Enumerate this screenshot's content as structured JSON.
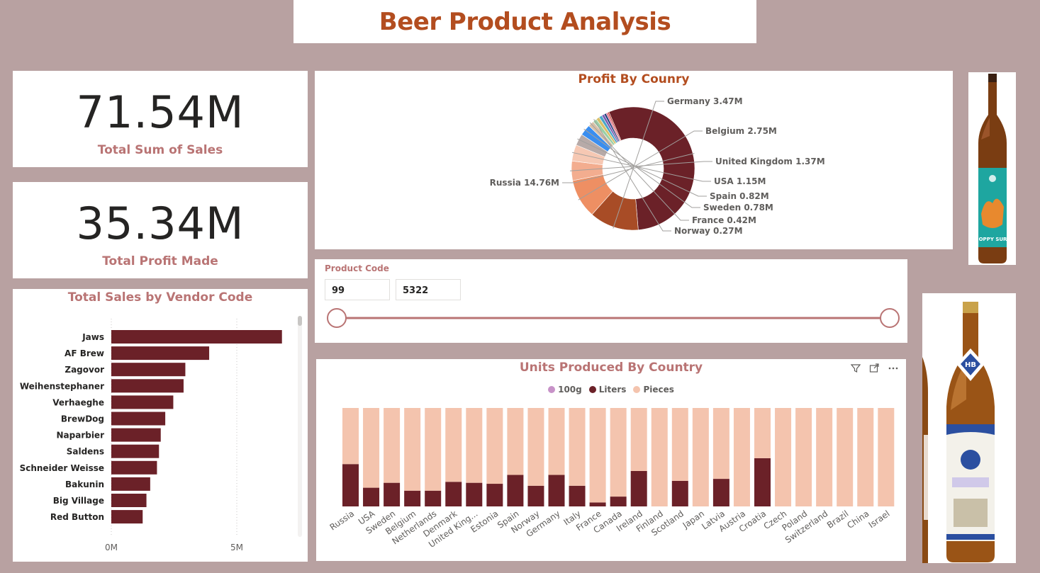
{
  "page": {
    "title": "Beer Product Analysis"
  },
  "kpis": {
    "sales": {
      "value": "71.54M",
      "label": "Total Sum of Sales"
    },
    "profit": {
      "value": "35.34M",
      "label": "Total Profit Made"
    }
  },
  "slicer": {
    "label": "Product Code",
    "min": "99",
    "max": "5322",
    "range": [
      99,
      5322
    ]
  },
  "images": {
    "bottle1_label": "HOPPY SURF",
    "bottle2_label": "HB"
  },
  "colors": {
    "accent": "#b34d1f",
    "label": "#b97474",
    "maroon": "#6b2128",
    "pieces": "#f4c4ae",
    "g100": "#c792c8"
  },
  "chart_data": [
    {
      "type": "bar",
      "orientation": "horizontal",
      "title": "Total Sales by Vendor Code",
      "categories": [
        "Jaws",
        "AF Brew",
        "Zagovor",
        "Weihenstephaner",
        "Verhaeghe",
        "BrewDog",
        "Naparbier",
        "Saldens",
        "Schneider Weisse",
        "Bakunin",
        "Big Village",
        "Red Button"
      ],
      "values": [
        6.8,
        3.9,
        2.95,
        2.88,
        2.47,
        2.15,
        1.97,
        1.9,
        1.82,
        1.55,
        1.4,
        1.25
      ],
      "value_unit": "M",
      "xlim": [
        0,
        8
      ],
      "x_ticks": [
        "0M",
        "5M"
      ],
      "grid": true
    },
    {
      "type": "pie",
      "donut": true,
      "title": "Profit By Counry",
      "slices": [
        {
          "label": "Russia",
          "value": 14.76,
          "text": "Russia 14.76M",
          "color": "#6b2128"
        },
        {
          "label": "Germany",
          "value": 3.47,
          "text": "Germany 3.47M",
          "color": "#a84c26"
        },
        {
          "label": "Belgium",
          "value": 2.75,
          "text": "Belgium 2.75M",
          "color": "#ee8f63"
        },
        {
          "label": "United Kingdom",
          "value": 1.37,
          "text": "United Kingdom 1.37M",
          "color": "#f3ad8f"
        },
        {
          "label": "USA",
          "value": 1.15,
          "text": "USA 1.15M",
          "color": "#f6c8b3"
        },
        {
          "label": "Spain",
          "value": 0.82,
          "text": "Spain 0.82M",
          "color": "#b7aaa8"
        },
        {
          "label": "Sweden",
          "value": 0.78,
          "text": "Sweden 0.78M",
          "color": "#3a8ef0"
        },
        {
          "label": "France",
          "value": 0.42,
          "text": "France 0.42M",
          "color": "#d8c0a8"
        },
        {
          "label": "Norway",
          "value": 0.27,
          "text": "Norway 0.27M",
          "color": "#9ad0a6"
        },
        {
          "label": "",
          "value": 0.24,
          "text": "",
          "color": "#d9c06a"
        },
        {
          "label": "",
          "value": 0.22,
          "text": "",
          "color": "#4aa6c9"
        },
        {
          "label": "",
          "value": 0.18,
          "text": "",
          "color": "#7a5ab0"
        },
        {
          "label": "",
          "value": 0.15,
          "text": "",
          "color": "#1f3e7a"
        },
        {
          "label": "",
          "value": 0.12,
          "text": "",
          "color": "#e06b8a"
        },
        {
          "label": "",
          "value": 0.1,
          "text": "",
          "color": "#c0392b"
        }
      ]
    },
    {
      "type": "bar",
      "stacked": "100%",
      "title": "Units Produced By Country",
      "legend": [
        "100g",
        "Liters",
        "Pieces"
      ],
      "legend_position": "top-center",
      "categories": [
        "Russia",
        "USA",
        "Sweden",
        "Belgium",
        "Netherlands",
        "Denmark",
        "United King...",
        "Estonia",
        "Spain",
        "Norway",
        "Germany",
        "Italy",
        "France",
        "Canada",
        "Ireland",
        "Finland",
        "Scotland",
        "Japan",
        "Latvia",
        "Austria",
        "Croatia",
        "Czech",
        "Poland",
        "Switzerland",
        "Brazil",
        "China",
        "Israel"
      ],
      "series": [
        {
          "name": "100g",
          "values": [
            0,
            0,
            0,
            0,
            0,
            0,
            0,
            0,
            0,
            0,
            0,
            0,
            0,
            0,
            0,
            0,
            0,
            0,
            0,
            0,
            0,
            0,
            0,
            0,
            0,
            0,
            0
          ]
        },
        {
          "name": "Liters",
          "values": [
            43,
            19,
            24,
            16,
            16,
            25,
            24,
            23,
            32,
            21,
            32,
            21,
            4,
            10,
            36,
            0,
            26,
            0,
            28,
            0,
            49,
            0,
            0,
            0,
            0,
            0,
            0
          ]
        },
        {
          "name": "Pieces",
          "values": [
            57,
            81,
            76,
            84,
            84,
            75,
            76,
            77,
            68,
            79,
            68,
            79,
            96,
            90,
            64,
            100,
            74,
            100,
            72,
            100,
            51,
            100,
            100,
            100,
            100,
            100,
            100
          ]
        }
      ],
      "ylim": [
        0,
        100
      ]
    }
  ]
}
